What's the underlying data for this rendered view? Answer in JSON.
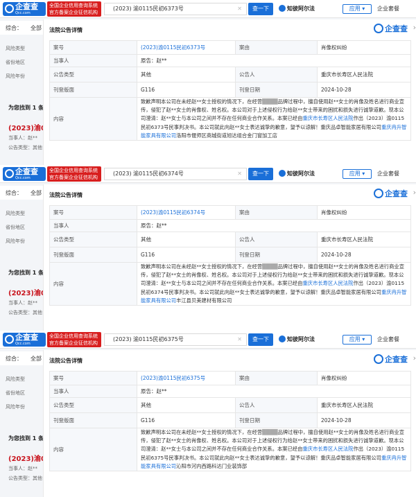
{
  "header": {
    "logo_text": "企查查",
    "logo_sub": "Qcc.com",
    "badge_text": "全国企业信用查询系统 官方备案企业征信机构",
    "search_button": "查一下",
    "zhi": "知彼阿尔法",
    "apps": "应用",
    "vip": "企业套餐"
  },
  "background": {
    "tab_overview": "综合：",
    "tab_all": "全部",
    "side_items": [
      "风险类型",
      "省份地区",
      "风险年份"
    ],
    "found_text": "为您找到 1 条",
    "case_prefix": "(2023)渝0",
    "party_line": "当事人：赵**",
    "type_line": "公告类型：其他"
  },
  "modal": {
    "title": "法院公告详情",
    "logo": "企查查",
    "labels": {
      "case_no": "案号",
      "cause": "案由",
      "party": "当事人",
      "type": "公告类型",
      "announcer": "公告人",
      "page": "刊登版面",
      "date": "刊登日期",
      "content": "内容"
    }
  },
  "panels": [
    {
      "search_value": "(2023) 渝0115民初6373号",
      "case_no": "(2023)渝0115民初6373号",
      "cause": "肖像权纠纷",
      "party": "原告：赵**",
      "type": "其他",
      "announcer": "重庆市长寿区人民法院",
      "page": "G116",
      "date": "2024-10-28",
      "content_1": "致歉声明本公司在未经赵**女士授权的情况下，在经营",
      "content_blur": "████",
      "content_2": "品牌过程中，擅自使用赵**女士的肖像及姓名进行商业宣传，侵犯了赵**女士的肖像权、姓名权。本公司对于上述侵权行为给赵**女士带来的困扰和损失进行诚挚道歉。现本公司澄清：赵**女士与本公司之间并不存在任何商业合作关系。本案已经由",
      "court_link": "重庆市长寿区人民法院",
      "content_3": "作出（2023）渝0115民初6373号民事判决书。本公司就此向赵**女士表达诚挚的歉意，望予以谅解！重庆品卓智能家居有限公司",
      "company_link": "重庆冉升智能家具有限公司",
      "content_4": "洛阳市偃师区商城街道旭达组合金门窗加工店"
    },
    {
      "search_value": "(2023) 渝0115民初6374号",
      "case_no": "(2023)渝0115民初6374号",
      "cause": "肖像权纠纷",
      "party": "原告：赵**",
      "type": "其他",
      "announcer": "重庆市长寿区人民法院",
      "page": "G116",
      "date": "2024-10-28",
      "content_1": "致歉声明本公司在未经赵**女士授权的情况下，在经营",
      "content_blur": "████",
      "content_2": "品牌过程中，擅自使用赵**女士的肖像及姓名进行商业宣传，侵犯了赵**女士的肖像权、姓名权。本公司对于上述侵权行为给赵**女士带来的困扰和损失进行诚挚道歉。现本公司澄清：赵**女士与本公司之间并不存在任何商业合作关系。本案已经由",
      "court_link": "重庆市长寿区人民法院",
      "content_3": "作出（2023）渝0115民初6374号民事判决书。本公司就此向赵**女士表达诚挚的歉意，望予以谅解！重庆品卓智能家居有限公司",
      "company_link": "重庆冉升智能家具有限公司",
      "content_4": "丰江县贝美建材有限公司"
    },
    {
      "search_value": "(2023) 渝0115民初6375号",
      "case_no": "(2023)渝0115民初6375号",
      "cause": "肖像权纠纷",
      "party": "原告：赵**",
      "type": "其他",
      "announcer": "重庆市长寿区人民法院",
      "page": "G116",
      "date": "2024-10-28",
      "content_1": "致歉声明本公司在未经赵**女士授权的情况下，在经营",
      "content_blur": "████",
      "content_2": "品牌过程中，擅自使用赵**女士的肖像及姓名进行商业宣传，侵犯了赵**女士的肖像权、姓名权。本公司对于上述侵权行为给赵**女士带来的困扰和损失进行诚挚道歉。现本公司澄清：赵**女士与本公司之间并不存在任何商业合作关系。本案已经由",
      "court_link": "重庆市长寿区人民法院",
      "content_3": "作出（2023）渝0115民初6375号民事判决书。本公司就此向赵**女士表达诚挚的歉意，望予以谅解！重庆品卓智能家居有限公司",
      "company_link": "重庆冉升智能家具有限公司",
      "content_4": "沁阳市河内西路科达门业装饰部"
    }
  ]
}
